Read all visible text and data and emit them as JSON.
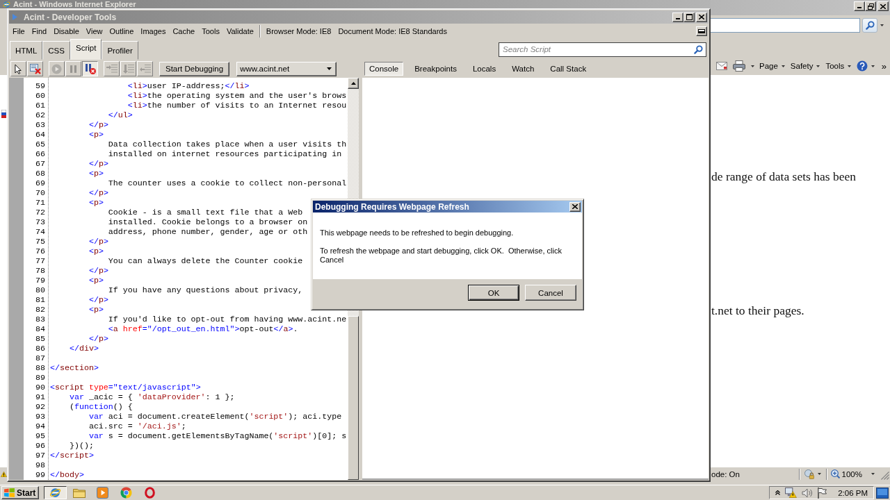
{
  "ie_window": {
    "title": "Acint - Windows Internet Explorer",
    "command_bar": [
      {
        "kind": "mail"
      },
      {
        "kind": "print"
      },
      {
        "kind": "menu",
        "label": "Page"
      },
      {
        "kind": "menu",
        "label": "Safety"
      },
      {
        "kind": "menu",
        "label": "Tools"
      },
      {
        "kind": "help"
      },
      {
        "kind": "overflow",
        "label": "»"
      }
    ],
    "page_text": [
      "de range of data sets has been",
      "t.net to their pages."
    ],
    "status_bar": {
      "mode": "ode: On",
      "zoom": "100%"
    }
  },
  "devtools": {
    "title": "Acint - Developer Tools",
    "menu": [
      "File",
      "Find",
      "Disable",
      "View",
      "Outline",
      "Images",
      "Cache",
      "Tools",
      "Validate"
    ],
    "modes": [
      "Browser Mode: IE8",
      "Document Mode: IE8 Standards"
    ],
    "tabs": [
      {
        "label": "HTML",
        "selected": false
      },
      {
        "label": "CSS",
        "selected": false
      },
      {
        "label": "Script",
        "selected": true
      },
      {
        "label": "Profiler",
        "selected": false
      }
    ],
    "search": {
      "placeholder": "Search Script"
    },
    "toolbar_groups": [
      [
        {
          "kind": "select",
          "on": false,
          "disabled": false
        },
        {
          "kind": "clear",
          "on": false,
          "disabled": false
        }
      ],
      [
        {
          "kind": "continue",
          "on": false,
          "disabled": true
        },
        {
          "kind": "break",
          "on": false,
          "disabled": true
        },
        {
          "kind": "break-on-error",
          "on": true,
          "disabled": false
        }
      ],
      [
        {
          "kind": "step-into",
          "on": false,
          "disabled": true
        },
        {
          "kind": "step-over",
          "on": false,
          "disabled": true
        },
        {
          "kind": "step-out",
          "on": false,
          "disabled": true
        }
      ]
    ],
    "start_button": "Start Debugging",
    "script_select": "www.acint.net",
    "pane_tabs": [
      {
        "label": "Console",
        "selected": true
      },
      {
        "label": "Breakpoints",
        "selected": false
      },
      {
        "label": "Locals",
        "selected": false
      },
      {
        "label": "Watch",
        "selected": false
      },
      {
        "label": "Call Stack",
        "selected": false
      }
    ],
    "code_lines": [
      {
        "number": "59",
        "tokens": [
          {
            "kind": "bracket",
            "text": "                <"
          },
          {
            "kind": "tag",
            "text": "li"
          },
          {
            "kind": "bracket",
            "text": ">"
          },
          {
            "kind": "text",
            "text": "user IP-address;"
          },
          {
            "kind": "bracket",
            "text": "</"
          },
          {
            "kind": "tag",
            "text": "li"
          },
          {
            "kind": "bracket",
            "text": ">"
          }
        ]
      },
      {
        "number": "60",
        "tokens": [
          {
            "kind": "bracket",
            "text": "                <"
          },
          {
            "kind": "tag",
            "text": "li"
          },
          {
            "kind": "bracket",
            "text": ">"
          },
          {
            "kind": "text",
            "text": "the operating system and the user's brows"
          }
        ]
      },
      {
        "number": "61",
        "tokens": [
          {
            "kind": "bracket",
            "text": "                <"
          },
          {
            "kind": "tag",
            "text": "li"
          },
          {
            "kind": "bracket",
            "text": ">"
          },
          {
            "kind": "text",
            "text": "the number of visits to an Internet resou"
          }
        ]
      },
      {
        "number": "62",
        "tokens": [
          {
            "kind": "bracket",
            "text": "            </"
          },
          {
            "kind": "tag",
            "text": "ul"
          },
          {
            "kind": "bracket",
            "text": ">"
          }
        ]
      },
      {
        "number": "63",
        "tokens": [
          {
            "kind": "bracket",
            "text": "        </"
          },
          {
            "kind": "tag",
            "text": "p"
          },
          {
            "kind": "bracket",
            "text": ">"
          }
        ]
      },
      {
        "number": "64",
        "tokens": [
          {
            "kind": "bracket",
            "text": "        <"
          },
          {
            "kind": "tag",
            "text": "p"
          },
          {
            "kind": "bracket",
            "text": ">"
          }
        ]
      },
      {
        "number": "65",
        "tokens": [
          {
            "kind": "text",
            "text": "            Data collection takes place when a user visits th"
          }
        ]
      },
      {
        "number": "66",
        "tokens": [
          {
            "kind": "text",
            "text": "            installed on internet resources participating in"
          }
        ]
      },
      {
        "number": "67",
        "tokens": [
          {
            "kind": "bracket",
            "text": "        </"
          },
          {
            "kind": "tag",
            "text": "p"
          },
          {
            "kind": "bracket",
            "text": ">"
          }
        ]
      },
      {
        "number": "68",
        "tokens": [
          {
            "kind": "bracket",
            "text": "        <"
          },
          {
            "kind": "tag",
            "text": "p"
          },
          {
            "kind": "bracket",
            "text": ">"
          }
        ]
      },
      {
        "number": "69",
        "tokens": [
          {
            "kind": "text",
            "text": "            The counter uses a cookie to collect non-personal"
          }
        ]
      },
      {
        "number": "70",
        "tokens": [
          {
            "kind": "bracket",
            "text": "        </"
          },
          {
            "kind": "tag",
            "text": "p"
          },
          {
            "kind": "bracket",
            "text": ">"
          }
        ]
      },
      {
        "number": "71",
        "tokens": [
          {
            "kind": "bracket",
            "text": "        <"
          },
          {
            "kind": "tag",
            "text": "p"
          },
          {
            "kind": "bracket",
            "text": ">"
          }
        ]
      },
      {
        "number": "72",
        "tokens": [
          {
            "kind": "text",
            "text": "            Cookie - is a small text file that a Web"
          }
        ]
      },
      {
        "number": "73",
        "tokens": [
          {
            "kind": "text",
            "text": "            installed. Cookie belongs to a browser on"
          }
        ]
      },
      {
        "number": "74",
        "tokens": [
          {
            "kind": "text",
            "text": "            address, phone number, gender, age or oth"
          }
        ]
      },
      {
        "number": "75",
        "tokens": [
          {
            "kind": "bracket",
            "text": "        </"
          },
          {
            "kind": "tag",
            "text": "p"
          },
          {
            "kind": "bracket",
            "text": ">"
          }
        ]
      },
      {
        "number": "76",
        "tokens": [
          {
            "kind": "bracket",
            "text": "        <"
          },
          {
            "kind": "tag",
            "text": "p"
          },
          {
            "kind": "bracket",
            "text": ">"
          }
        ]
      },
      {
        "number": "77",
        "tokens": [
          {
            "kind": "text",
            "text": "            You can always delete the Counter cookie"
          }
        ]
      },
      {
        "number": "78",
        "tokens": [
          {
            "kind": "bracket",
            "text": "        </"
          },
          {
            "kind": "tag",
            "text": "p"
          },
          {
            "kind": "bracket",
            "text": ">"
          }
        ]
      },
      {
        "number": "79",
        "tokens": [
          {
            "kind": "bracket",
            "text": "        <"
          },
          {
            "kind": "tag",
            "text": "p"
          },
          {
            "kind": "bracket",
            "text": ">"
          }
        ]
      },
      {
        "number": "80",
        "tokens": [
          {
            "kind": "text",
            "text": "            If you have any questions about privacy,"
          }
        ]
      },
      {
        "number": "81",
        "tokens": [
          {
            "kind": "bracket",
            "text": "        </"
          },
          {
            "kind": "tag",
            "text": "p"
          },
          {
            "kind": "bracket",
            "text": ">"
          }
        ]
      },
      {
        "number": "82",
        "tokens": [
          {
            "kind": "bracket",
            "text": "        <"
          },
          {
            "kind": "tag",
            "text": "p"
          },
          {
            "kind": "bracket",
            "text": ">"
          }
        ]
      },
      {
        "number": "83",
        "tokens": [
          {
            "kind": "text",
            "text": "            If you'd like to opt-out from having www.acint.ne"
          }
        ]
      },
      {
        "number": "84",
        "tokens": [
          {
            "kind": "bracket",
            "text": "            <"
          },
          {
            "kind": "tag",
            "text": "a"
          },
          {
            "kind": "attribute",
            "text": " href"
          },
          {
            "kind": "bracket",
            "text": "="
          },
          {
            "kind": "value",
            "text": "\"/opt_out_en.html\""
          },
          {
            "kind": "bracket",
            "text": ">"
          },
          {
            "kind": "text",
            "text": "opt-out"
          },
          {
            "kind": "bracket",
            "text": "</"
          },
          {
            "kind": "tag",
            "text": "a"
          },
          {
            "kind": "bracket",
            "text": ">"
          },
          {
            "kind": "text",
            "text": "."
          }
        ]
      },
      {
        "number": "85",
        "tokens": [
          {
            "kind": "bracket",
            "text": "        </"
          },
          {
            "kind": "tag",
            "text": "p"
          },
          {
            "kind": "bracket",
            "text": ">"
          }
        ]
      },
      {
        "number": "86",
        "tokens": [
          {
            "kind": "bracket",
            "text": "    </"
          },
          {
            "kind": "tag",
            "text": "div"
          },
          {
            "kind": "bracket",
            "text": ">"
          }
        ]
      },
      {
        "number": "87"
      },
      {
        "number": "88",
        "tokens": [
          {
            "kind": "bracket",
            "text": "</"
          },
          {
            "kind": "tag",
            "text": "section"
          },
          {
            "kind": "bracket",
            "text": ">"
          }
        ]
      },
      {
        "number": "89"
      },
      {
        "number": "90",
        "tokens": [
          {
            "kind": "bracket",
            "text": "<"
          },
          {
            "kind": "tag",
            "text": "script"
          },
          {
            "kind": "attribute",
            "text": " type"
          },
          {
            "kind": "bracket",
            "text": "="
          },
          {
            "kind": "value",
            "text": "\"text/javascript\""
          },
          {
            "kind": "bracket",
            "text": ">"
          }
        ]
      },
      {
        "number": "91",
        "tokens": [
          {
            "kind": "keyword",
            "text": "    var"
          },
          {
            "kind": "text",
            "text": " _acic = { "
          },
          {
            "kind": "string",
            "text": "'dataProvider'"
          },
          {
            "kind": "text",
            "text": ": 1 };"
          }
        ]
      },
      {
        "number": "92",
        "tokens": [
          {
            "kind": "text",
            "text": "    ("
          },
          {
            "kind": "keyword",
            "text": "function"
          },
          {
            "kind": "text",
            "text": "() {"
          }
        ]
      },
      {
        "number": "93",
        "tokens": [
          {
            "kind": "keyword",
            "text": "        var"
          },
          {
            "kind": "text",
            "text": " aci = document.createElement("
          },
          {
            "kind": "string",
            "text": "'script'"
          },
          {
            "kind": "text",
            "text": "); aci.type"
          }
        ]
      },
      {
        "number": "94",
        "tokens": [
          {
            "kind": "text",
            "text": "        aci.src = "
          },
          {
            "kind": "string",
            "text": "'/aci.js'"
          },
          {
            "kind": "text",
            "text": ";"
          }
        ]
      },
      {
        "number": "95",
        "tokens": [
          {
            "kind": "keyword",
            "text": "        var"
          },
          {
            "kind": "text",
            "text": " s = document.getElementsByTagName("
          },
          {
            "kind": "string",
            "text": "'script'"
          },
          {
            "kind": "text",
            "text": ")[0]; s"
          }
        ]
      },
      {
        "number": "96",
        "tokens": [
          {
            "kind": "text",
            "text": "    })();"
          }
        ]
      },
      {
        "number": "97",
        "tokens": [
          {
            "kind": "bracket",
            "text": "</"
          },
          {
            "kind": "tag",
            "text": "script"
          },
          {
            "kind": "bracket",
            "text": ">"
          }
        ]
      },
      {
        "number": "98"
      },
      {
        "number": "99",
        "tokens": [
          {
            "kind": "bracket",
            "text": "</"
          },
          {
            "kind": "tag",
            "text": "body"
          },
          {
            "kind": "bracket",
            "text": ">"
          }
        ]
      }
    ]
  },
  "dialog": {
    "title": "Debugging Requires Webpage Refresh",
    "messages": [
      "This webpage needs to be refreshed to begin debugging.",
      "To refresh the webpage and start debugging, click OK.  Otherwise, click Cancel"
    ],
    "buttons": [
      {
        "label": "OK",
        "default": true
      },
      {
        "label": "Cancel",
        "default": false
      }
    ]
  },
  "taskbar": {
    "start": "Start",
    "apps": [
      {
        "kind": "globe",
        "selected": true
      },
      {
        "kind": "folder",
        "selected": false
      },
      {
        "kind": "player",
        "selected": false
      },
      {
        "kind": "segmented",
        "selected": false
      },
      {
        "kind": "ring",
        "selected": false
      }
    ],
    "tray": [
      {
        "kind": "chevron"
      },
      {
        "kind": "network"
      },
      {
        "kind": "speaker"
      },
      {
        "kind": "flag"
      }
    ],
    "clock": "2:06 PM"
  }
}
